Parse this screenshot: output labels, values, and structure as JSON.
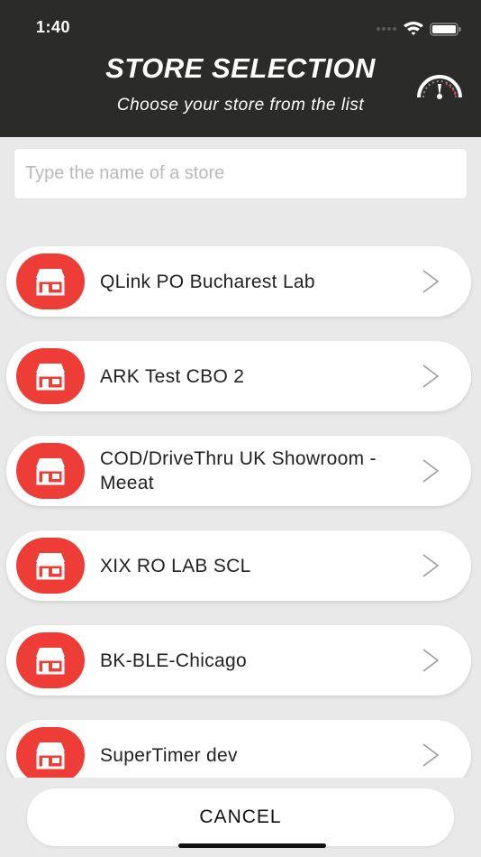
{
  "status_bar": {
    "time": "1:40"
  },
  "header": {
    "title": "STORE SELECTION",
    "subtitle": "Choose your store from the list",
    "gauge_icon": "speedometer-icon"
  },
  "search": {
    "placeholder": "Type the name of a store",
    "value": ""
  },
  "stores": [
    {
      "name": "QLink PO Bucharest Lab"
    },
    {
      "name": "ARK Test CBO 2"
    },
    {
      "name": "COD/DriveThru UK Showroom - Meeat"
    },
    {
      "name": "XIX RO LAB SCL"
    },
    {
      "name": "BK-BLE-Chicago"
    },
    {
      "name": "SuperTimer dev"
    }
  ],
  "cancel_label": "CANCEL",
  "colors": {
    "header": "#2b2b2a",
    "accent": "#ee3c36",
    "background": "#e9e9e9"
  }
}
